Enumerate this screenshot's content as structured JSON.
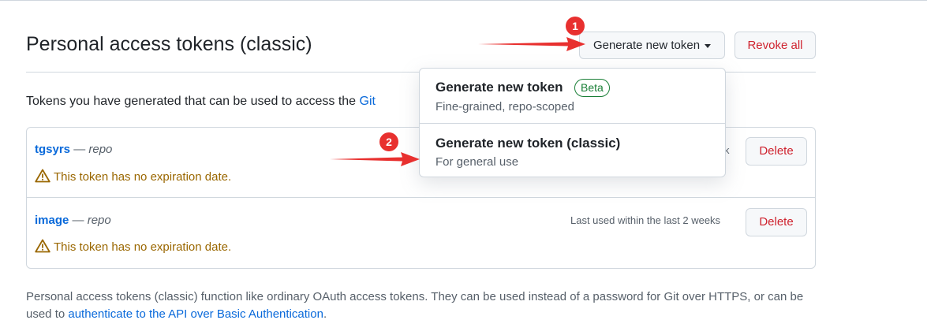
{
  "header": {
    "title": "Personal access tokens (classic)",
    "generate_button": "Generate new token",
    "revoke_button": "Revoke all"
  },
  "intro": {
    "text": "Tokens you have generated that can be used to access the ",
    "link": "Git"
  },
  "tokens": [
    {
      "name": "tgsyrs",
      "separator": " — ",
      "scope": "repo",
      "warning": "This token has no expiration date.",
      "last_used": "k",
      "delete_label": "Delete"
    },
    {
      "name": "image",
      "separator": " — ",
      "scope": "repo",
      "warning": "This token has no expiration date.",
      "last_used": "Last used within the last 2 weeks",
      "delete_label": "Delete"
    }
  ],
  "dropdown": {
    "items": [
      {
        "title": "Generate new token",
        "badge": "Beta",
        "description": "Fine-grained, repo-scoped"
      },
      {
        "title": "Generate new token (classic)",
        "description": "For general use"
      }
    ]
  },
  "footer": {
    "text": "Personal access tokens (classic) function like ordinary OAuth access tokens. They can be used instead of a password for Git over HTTPS, or can be used to ",
    "link": "authenticate to the API over Basic Authentication",
    "suffix": "."
  },
  "annotations": [
    {
      "number": "1"
    },
    {
      "number": "2"
    }
  ],
  "colors": {
    "link": "#0969da",
    "danger": "#cf222e",
    "warning": "#9a6700",
    "annotation": "#e8302f",
    "beta": "#1a7f37"
  }
}
